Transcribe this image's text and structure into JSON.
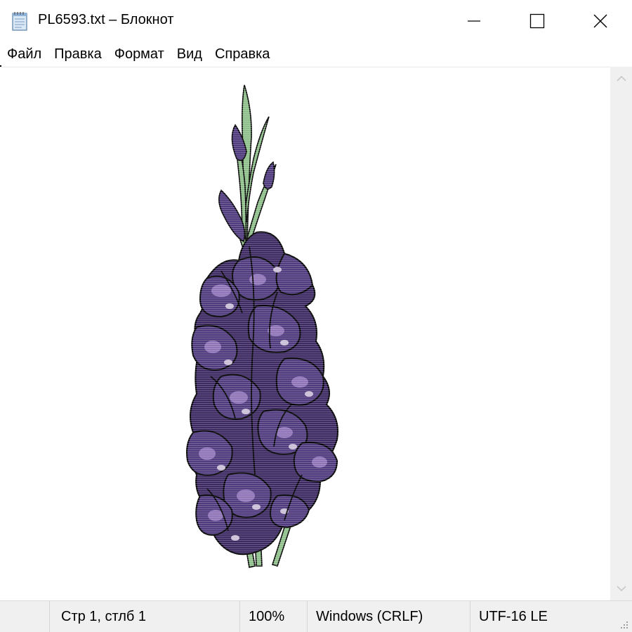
{
  "window": {
    "title": "PL6593.txt – Блокнот",
    "app_icon": "notepad-icon",
    "controls": {
      "minimize_icon": "minimize-icon",
      "maximize_icon": "maximize-icon",
      "close_icon": "close-icon"
    }
  },
  "menu": {
    "items": [
      {
        "label": "Файл"
      },
      {
        "label": "Правка"
      },
      {
        "label": "Формат"
      },
      {
        "label": "Вид"
      },
      {
        "label": "Справка"
      }
    ]
  },
  "editor": {
    "content_icon": "gladiolus-ascii-art",
    "colors": {
      "petal_dark": "#3e2a63",
      "petal_mid": "#4f3b7d",
      "petal_light": "#8f74b8",
      "petal_center": "#c9bfd6",
      "stem": "#8fbf8a",
      "outline": "#000000"
    }
  },
  "scrollbar": {
    "up_icon": "chevron-up-icon",
    "down_icon": "chevron-down-icon"
  },
  "status": {
    "position": "Стр 1, стлб 1",
    "zoom": "100%",
    "line_endings": "Windows (CRLF)",
    "encoding": "UTF-16 LE",
    "grip_icon": "resize-grip-icon"
  }
}
